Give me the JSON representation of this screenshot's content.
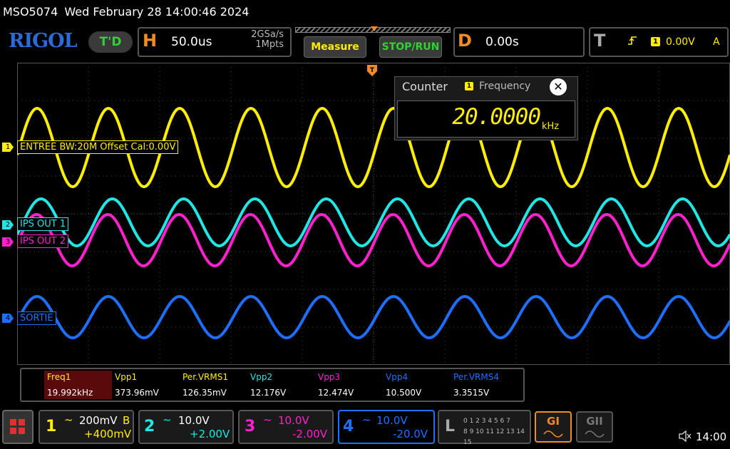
{
  "title_bar": {
    "model": "MSO5074",
    "datetime": "Wed February 28 14:00:46 2024"
  },
  "brand": {
    "logo": "RIGOL",
    "mode_badge": "T'D"
  },
  "horizontal": {
    "letter": "H",
    "timebase": "50.0us",
    "sample_rate": "2GSa/s",
    "memory_depth": "1Mpts"
  },
  "buttons": {
    "measure": "Measure",
    "stop_run": "STOP/RUN"
  },
  "delay": {
    "letter": "D",
    "value": "0.00s"
  },
  "trigger": {
    "letter": "T",
    "slope_icon": "rising-edge-icon",
    "source": "1",
    "level": "0.00V",
    "mode": "A"
  },
  "counter": {
    "title": "Counter",
    "source": "1",
    "mode": "Frequency",
    "value": "20.0000",
    "unit": "kHz",
    "close": "✕"
  },
  "channels": [
    {
      "id": "1",
      "label": "ENTREE BW:20M Offset Cal:0.00V",
      "color": "#ffee00",
      "scale": "200mV",
      "bw_flag": "B",
      "offset": "+400mV",
      "coupling": "~"
    },
    {
      "id": "2",
      "label": "IPS OUT 1",
      "color": "#20e6e6",
      "scale": "10.0V",
      "offset": "+2.00V",
      "coupling": "~"
    },
    {
      "id": "3",
      "label": "IPS OUT 2",
      "color": "#ff22cc",
      "scale": "10.0V",
      "offset": "-2.00V",
      "coupling": "~"
    },
    {
      "id": "4",
      "label": "SORTIE",
      "color": "#1f6fff",
      "scale": "10.0V",
      "offset": "-20.0V",
      "coupling": "~"
    }
  ],
  "measurements": [
    {
      "name": "Freq1",
      "value": "19.992kHz",
      "color": "#ffee00"
    },
    {
      "name": "Vpp1",
      "value": "373.96mV",
      "color": "#ffee00"
    },
    {
      "name": "Per.VRMS1",
      "value": "126.35mV",
      "color": "#ffee00"
    },
    {
      "name": "Vpp2",
      "value": "12.176V",
      "color": "#20e6e6"
    },
    {
      "name": "Vpp3",
      "value": "12.474V",
      "color": "#ff22cc"
    },
    {
      "name": "Vpp4",
      "value": "10.500V",
      "color": "#1f6fff"
    },
    {
      "name": "Per.VRMS4",
      "value": "3.3515V",
      "color": "#1f6fff"
    }
  ],
  "logic": {
    "letter": "L",
    "row1": "0 1 2 3  4 5 6 7",
    "row2": "8 9 10 11 12 13 14 15"
  },
  "generators": {
    "g1": "GI",
    "g2": "GII"
  },
  "status": {
    "time": "14:00",
    "sound_icon": "speaker-muted-icon"
  },
  "waveforms": {
    "frequency_khz": 20.0,
    "timebase_us_per_div": 50.0
  }
}
